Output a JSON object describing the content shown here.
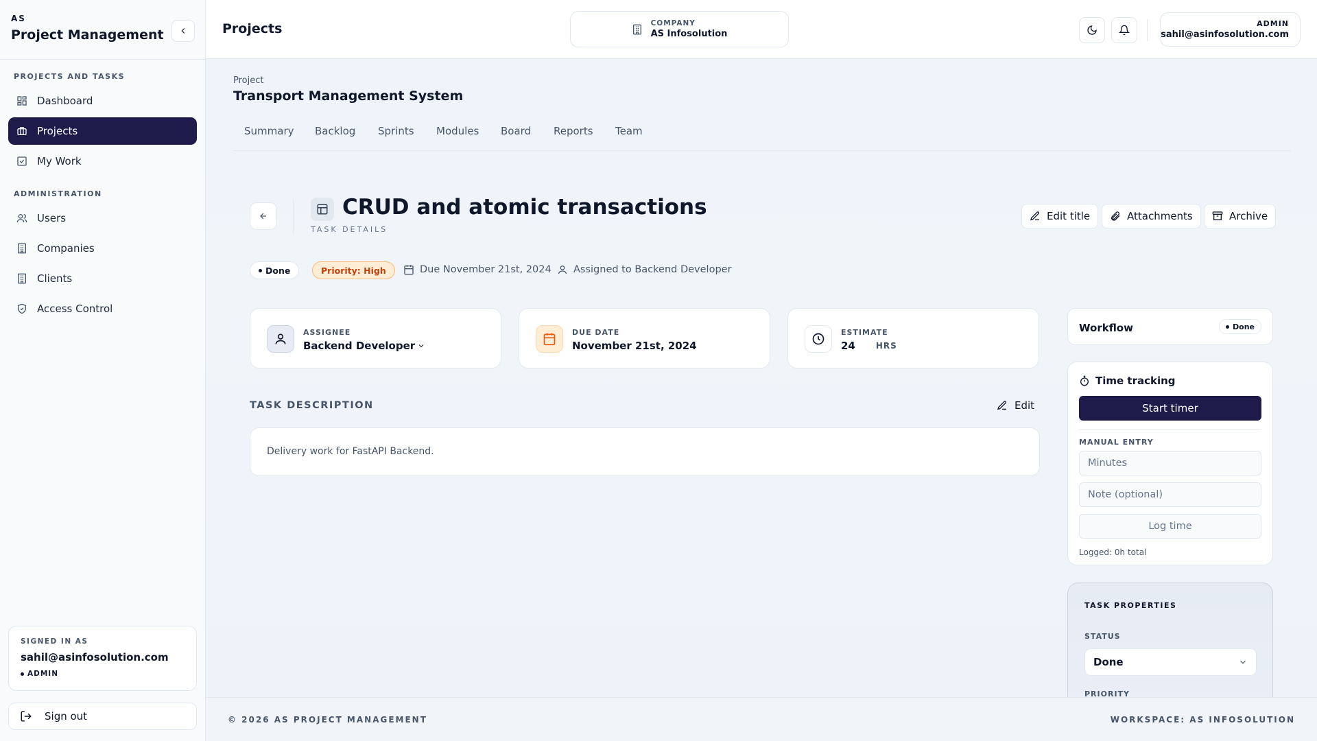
{
  "sidebar": {
    "brand_sub": "AS",
    "brand_title": "Project Management",
    "sections": {
      "projects_tasks": "PROJECTS AND TASKS",
      "administration": "ADMINISTRATION"
    },
    "items": [
      {
        "label": "Dashboard",
        "icon": "dashboard-icon"
      },
      {
        "label": "Projects",
        "icon": "briefcase-icon",
        "active": true
      },
      {
        "label": "My Work",
        "icon": "checkbox-icon"
      },
      {
        "label": "Users",
        "icon": "users-icon"
      },
      {
        "label": "Companies",
        "icon": "building-icon"
      },
      {
        "label": "Clients",
        "icon": "building-icon"
      },
      {
        "label": "Access Control",
        "icon": "shield-icon"
      }
    ],
    "signed_in_label": "SIGNED IN AS",
    "signed_in_email": "sahil@asinfosolution.com",
    "signed_in_role": "ADMIN",
    "sign_out": "Sign out"
  },
  "header": {
    "title": "Projects",
    "company_label": "COMPANY",
    "company_name": "AS Infosolution",
    "user_role": "ADMIN",
    "user_email": "sahil@asinfosolution.com"
  },
  "project": {
    "label": "Project",
    "name": "Transport Management System",
    "tabs": [
      "Summary",
      "Backlog",
      "Sprints",
      "Modules",
      "Board",
      "Reports",
      "Team"
    ]
  },
  "task": {
    "title": "CRUD and atomic transactions",
    "subtitle": "TASK DETAILS",
    "actions": {
      "edit_title": "Edit title",
      "attachments": "Attachments",
      "archive": "Archive"
    },
    "status": "Done",
    "priority": "Priority: High",
    "due_meta": "Due November 21st, 2024",
    "assigned_meta": "Assigned to Backend Developer",
    "assignee_label": "ASSIGNEE",
    "assignee_value": "Backend Developer",
    "due_label": "DUE DATE",
    "due_value": "November 21st, 2024",
    "estimate_label": "ESTIMATE",
    "estimate_value": "24",
    "estimate_unit": "HRS",
    "description_label": "TASK DESCRIPTION",
    "description_edit": "Edit",
    "description_text": "Delivery work for FastAPI Backend."
  },
  "workflow": {
    "title": "Workflow",
    "badge": "Done"
  },
  "time_tracking": {
    "title": "Time tracking",
    "start_timer": "Start timer",
    "manual_entry": "MANUAL ENTRY",
    "minutes_placeholder": "Minutes",
    "note_placeholder": "Note (optional)",
    "log_time": "Log time",
    "logged": "Logged: 0h total"
  },
  "task_properties": {
    "title": "TASK PROPERTIES",
    "status_label": "STATUS",
    "status_value": "Done",
    "priority_label": "PRIORITY"
  },
  "footer": {
    "left": "© 2026 AS PROJECT MANAGEMENT",
    "right": "WORKSPACE: AS INFOSOLUTION"
  },
  "colors": {
    "accent": "#1e1b4b",
    "priority_bg": "#ffedd5",
    "priority_text": "#c2410c"
  }
}
